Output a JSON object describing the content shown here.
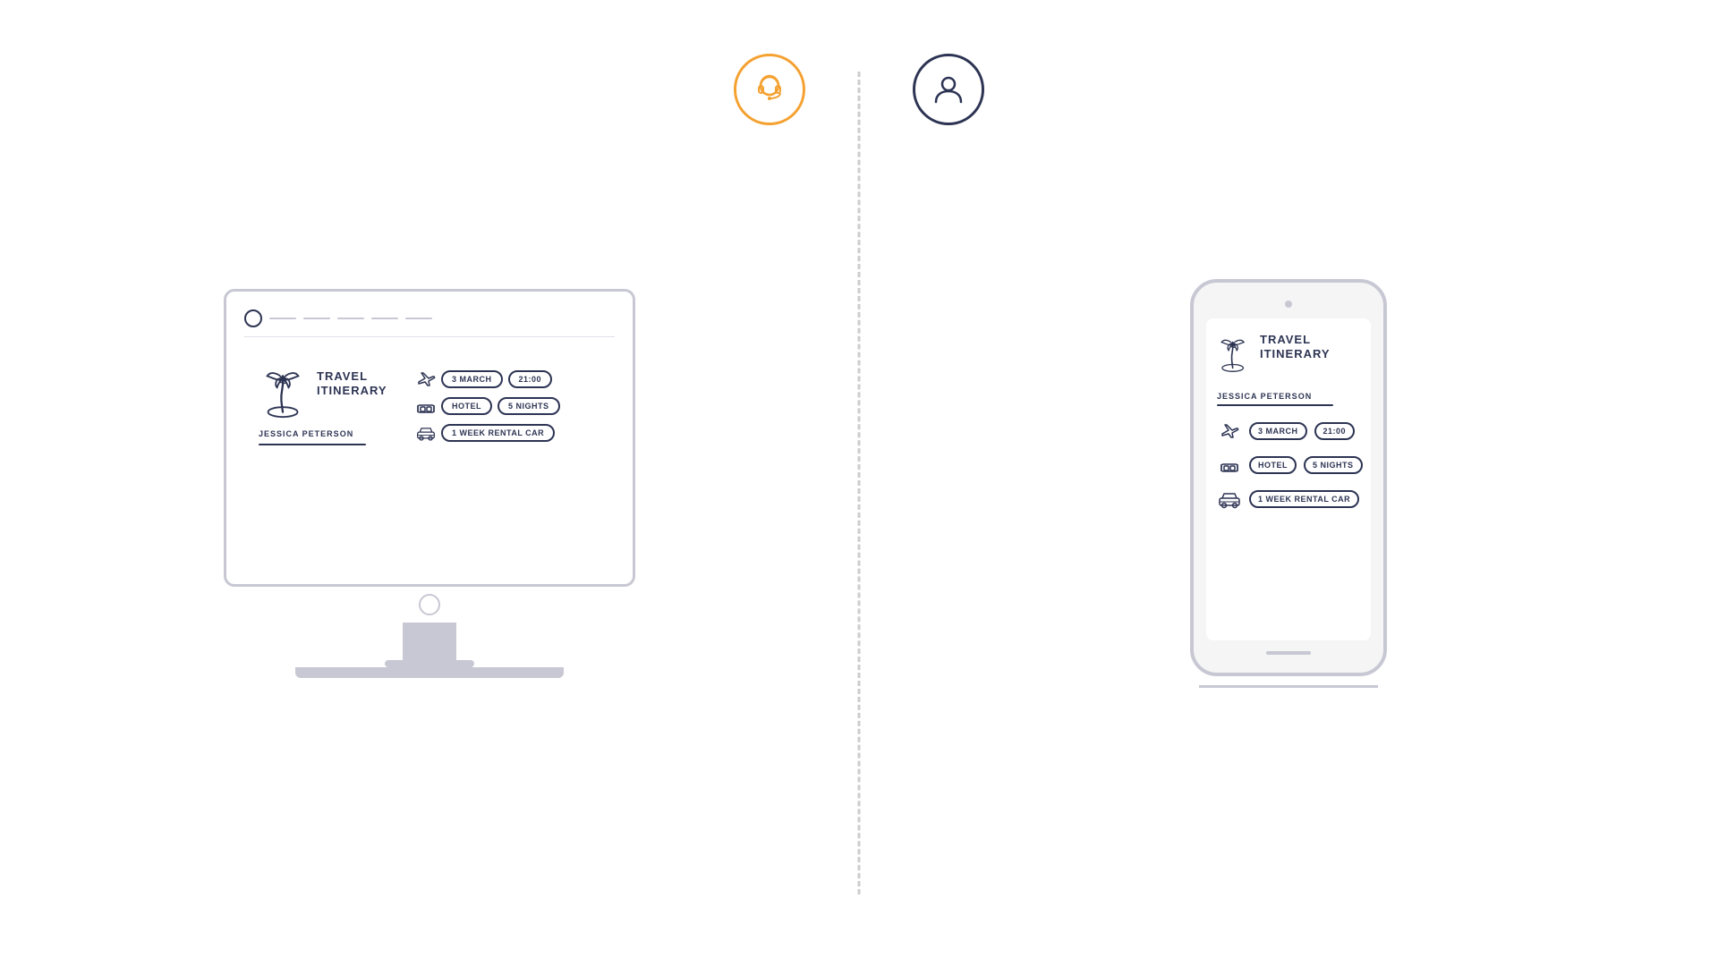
{
  "page": {
    "background": "#ffffff"
  },
  "icons": {
    "support_icon": "headset-icon",
    "user_icon": "user-icon"
  },
  "left": {
    "device": "desktop",
    "card": {
      "title": "TRAVEL\nITINERARY",
      "name": "JESSICA PETERSON",
      "rows": [
        {
          "icon": "plane-icon",
          "pills": [
            "3 MARCH",
            "21:00"
          ]
        },
        {
          "icon": "hotel-icon",
          "pills": [
            "HOTEL",
            "5 NIGHTS"
          ]
        },
        {
          "icon": "car-icon",
          "pills": [
            "1 WEEK RENTAL CAR"
          ]
        }
      ]
    }
  },
  "right": {
    "device": "mobile",
    "card": {
      "title": "TRAVEL\nITINERARY",
      "name": "JESSICA PETERSON",
      "rows": [
        {
          "icon": "plane-icon",
          "pills": [
            "3 MARCH",
            "21:00"
          ]
        },
        {
          "icon": "hotel-icon",
          "pills": [
            "HOTEL",
            "5 NIGHTS"
          ]
        },
        {
          "icon": "car-icon",
          "pills": [
            "1 WEEK RENTAL CAR"
          ]
        }
      ]
    }
  }
}
